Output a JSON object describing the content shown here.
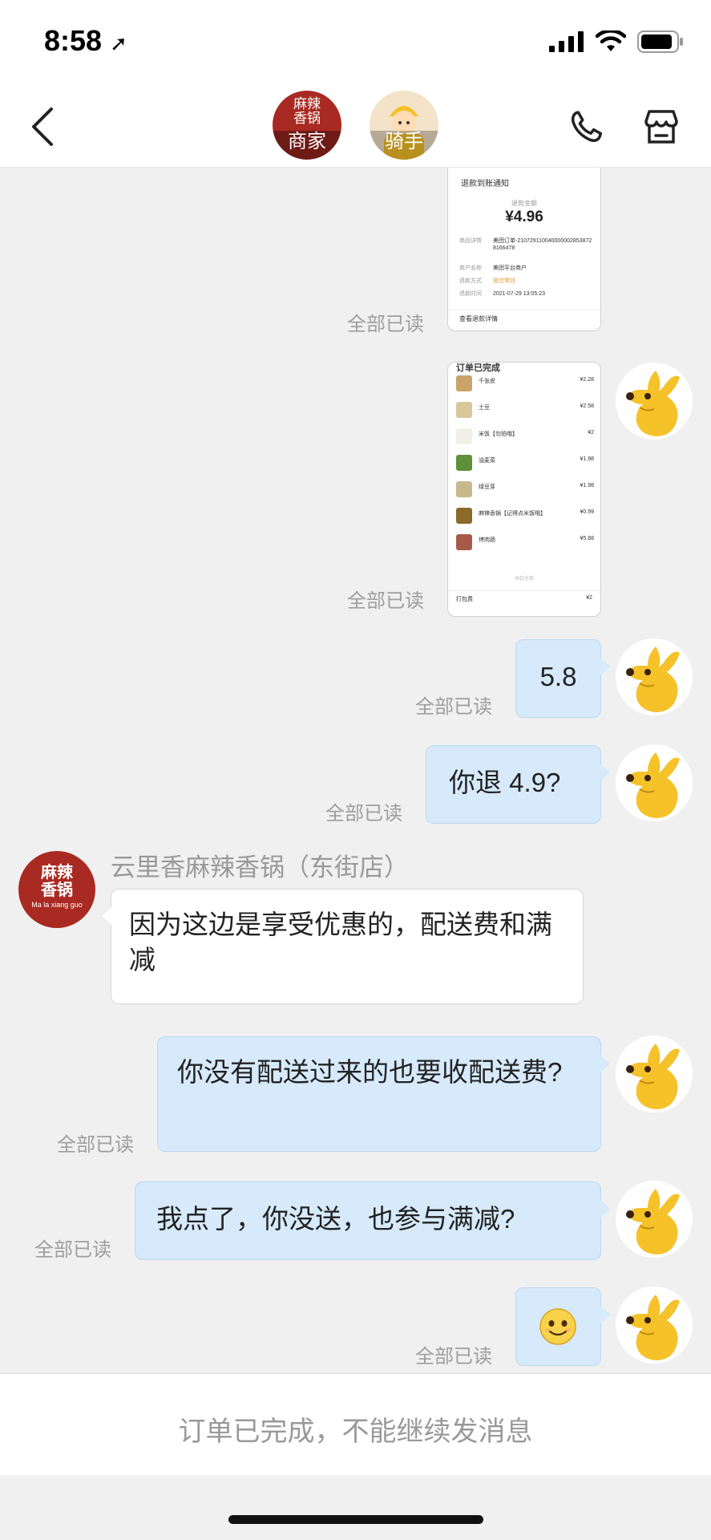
{
  "status_bar": {
    "time": "8:58"
  },
  "nav": {
    "merchant_tab_label": "商家",
    "merchant_logo_text": "麻辣香锅",
    "rider_tab_label": "骑手"
  },
  "refund_card": {
    "title": "退款到账通知",
    "amount_label": "退款金额",
    "amount": "¥4.96",
    "rows": [
      {
        "label": "商品详情",
        "value": "美团订单-2107291100400000028538728166478"
      },
      {
        "label": "商户名称",
        "value": "美团平台商户"
      },
      {
        "label": "退款方式",
        "value": "微信零钱"
      },
      {
        "label": "退款时间",
        "value": "2021-07-29 13:05:23"
      }
    ],
    "link": "查看退款详情"
  },
  "order_card": {
    "title": "订单已完成",
    "items": [
      {
        "name": "千张皮",
        "price": "¥2.28"
      },
      {
        "name": "土豆",
        "price": "¥2.58"
      },
      {
        "name": "米饭【勿拍哦】",
        "price": "¥2"
      },
      {
        "name": "油麦菜",
        "price": "¥1.98"
      },
      {
        "name": "绿豆芽",
        "price": "¥1.98"
      },
      {
        "name": "麻辣香锅【记得点米饭哦】",
        "price": "¥0.99"
      },
      {
        "name": "烤肉肠",
        "price": "¥5.88"
      }
    ],
    "collapse_label": "收起全部",
    "footer_label": "打包费",
    "footer_value": "¥2"
  },
  "messages": [
    {
      "text": "5.8",
      "status": "全部已读"
    },
    {
      "text": "你退 4.9?",
      "status": "全部已读"
    },
    {
      "text": "因为这边是享受优惠的，配送费和满减"
    },
    {
      "text": "你没有配送过来的也要收配送费?",
      "status": "全部已读"
    },
    {
      "text": "我点了，你没送，也参与满减?",
      "status": "全部已读"
    },
    {
      "status": "全部已读"
    }
  ],
  "read_status_card1": "全部已读",
  "read_status_card2": "全部已读",
  "shop": {
    "name": "云里香麻辣香锅（东街店）",
    "logo_text": "麻辣香锅",
    "logo_sub": "Ma la xiang guo"
  },
  "footer": {
    "text": "订单已完成，不能继续发消息"
  },
  "colors": {
    "bubble_self": "#d6eafb",
    "merchant_red": "#a92a22",
    "mascot_yellow": "#f5c22a"
  }
}
